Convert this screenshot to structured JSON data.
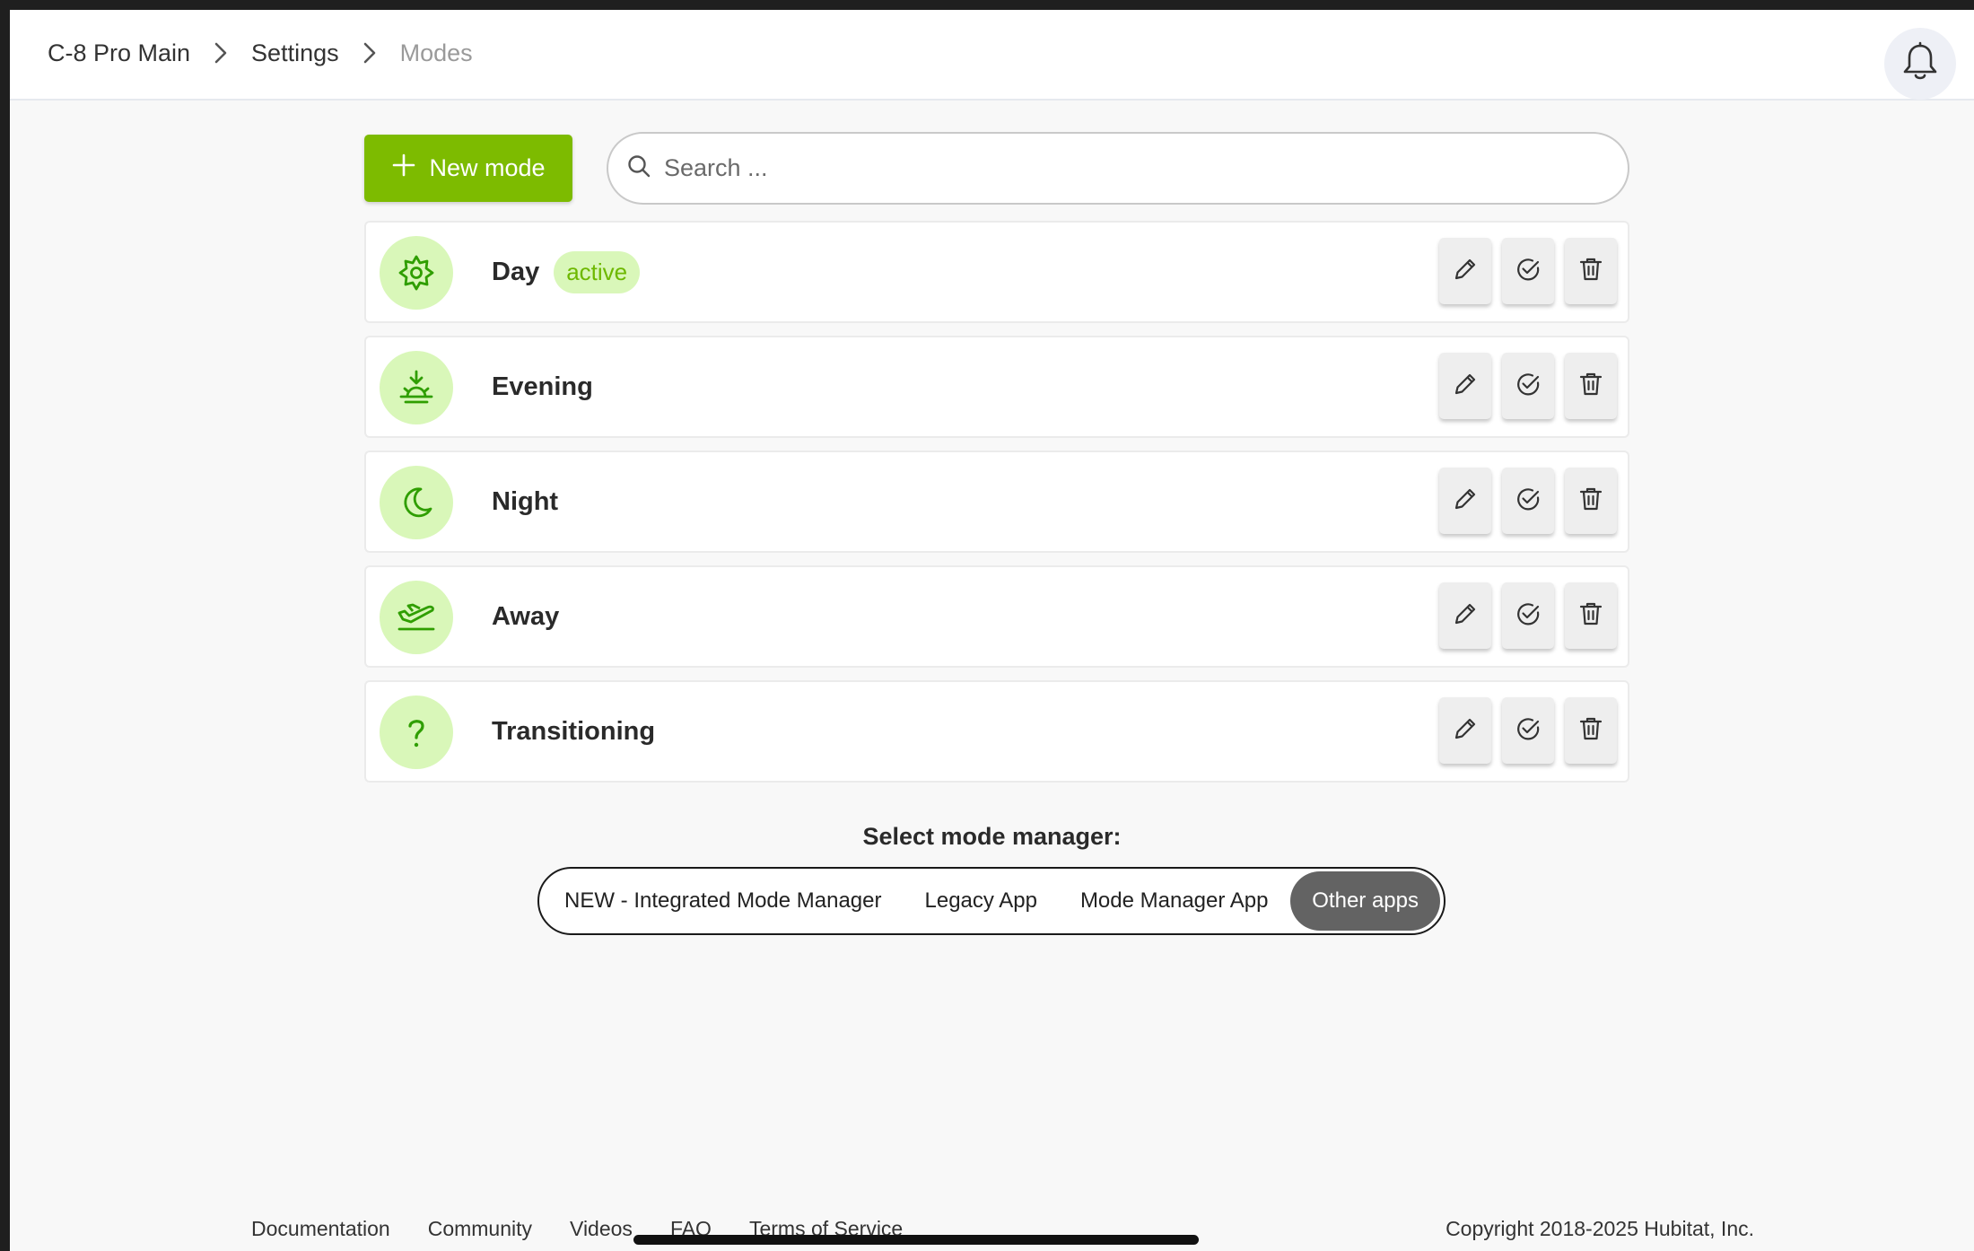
{
  "breadcrumb": {
    "hub": "C-8 Pro Main",
    "section": "Settings",
    "page": "Modes"
  },
  "toolbar": {
    "new_mode_label": "New mode",
    "search_placeholder": "Search ..."
  },
  "modes": [
    {
      "name": "Day",
      "icon": "sun-gear-icon",
      "badge": "active"
    },
    {
      "name": "Evening",
      "icon": "sunset-icon"
    },
    {
      "name": "Night",
      "icon": "moon-icon"
    },
    {
      "name": "Away",
      "icon": "plane-departure-icon"
    },
    {
      "name": "Transitioning",
      "icon": "question-mark-icon"
    }
  ],
  "mode_manager": {
    "title": "Select mode manager:",
    "options": [
      "NEW - Integrated Mode Manager",
      "Legacy App",
      "Mode Manager App",
      "Other apps"
    ],
    "selected": "Other apps"
  },
  "footer": {
    "links": [
      "Documentation",
      "Community",
      "Videos",
      "FAQ",
      "Terms of Service"
    ],
    "copyright": "Copyright 2018-2025 Hubitat, Inc."
  },
  "colors": {
    "accent": "#7dbb00",
    "icon_bg": "#d9f7b9",
    "icon_fg": "#2f9e00",
    "selected_option": "#636363"
  }
}
